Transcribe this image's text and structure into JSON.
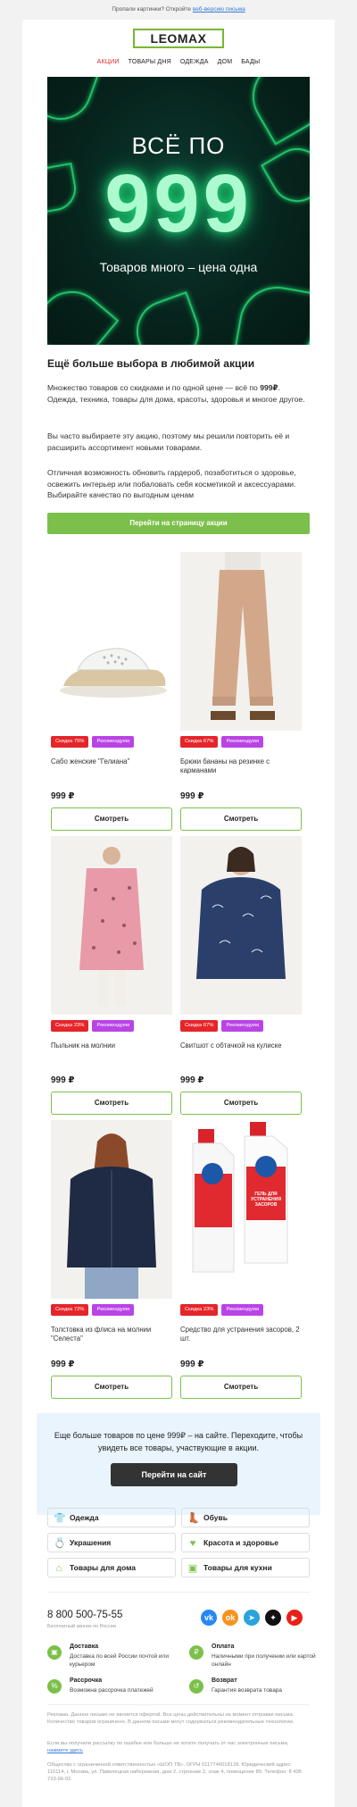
{
  "preheader": {
    "text": "Пропали картинки? Откройте",
    "link": "веб-версию письма"
  },
  "logo": "LEOMAX",
  "nav": [
    {
      "label": "АКЦИИ",
      "active": true
    },
    {
      "label": "ТОВАРЫ ДНЯ",
      "active": false
    },
    {
      "label": "ОДЕЖДА",
      "active": false
    },
    {
      "label": "ДОМ",
      "active": false
    },
    {
      "label": "БАДЫ",
      "active": false
    }
  ],
  "hero": {
    "line1": "ВСЁ ПО",
    "number": "999",
    "line2": "Товаров много – цена одна"
  },
  "intro": {
    "title": "Ещё больше выбора в любимой акции",
    "p1_a": "Множество товаров со скидками и по одной цене — всё по ",
    "p1_bold": "999₽",
    "p1_b": ". Одежда, техника, товары для дома, красоты, здоровья и многое другое.",
    "p2": "Вы часто выбираете эту акцию, поэтому мы решили повторить её и расширить ассортимент новыми товарами.",
    "p3": "Отличная возможность обновить гардероб, позаботиться о здоровье, освежить интерьер или побаловать себя косметикой и аксессуарами. Выбирайте качество по выгодным ценам",
    "cta": "Перейти на страницу акции"
  },
  "products": [
    {
      "name": "Сабо женские \"Гелиана\"",
      "sale": "Скидка 75%",
      "rec": "Рекомендуем",
      "price": "999 ₽",
      "button": "Смотреть"
    },
    {
      "name": "Брюки бананы на резинке с карманами",
      "sale": "Скидка 67%",
      "rec": "Рекомендуем",
      "price": "999 ₽",
      "button": "Смотреть"
    },
    {
      "name": "Пыльник на молнии",
      "sale": "Скидка 23%",
      "rec": "Рекомендуем",
      "price": "999 ₽",
      "button": "Смотреть"
    },
    {
      "name": "Свитшот с обтачкой на кулиске",
      "sale": "Скидка 67%",
      "rec": "Рекомендуем",
      "price": "999 ₽",
      "button": "Смотреть"
    },
    {
      "name": "Толстовка из флиса на молнии \"Селеста\"",
      "sale": "Скидка 72%",
      "rec": "Рекомендуем",
      "price": "999 ₽",
      "button": "Смотреть"
    },
    {
      "name": "Средство для устранения засоров, 2 шт.",
      "sale": "Скидка 23%",
      "rec": "Рекомендуем",
      "price": "999 ₽",
      "button": "Смотреть"
    }
  ],
  "product_label_text": "ГЕЛЬ ДЛЯ УСТРАНЕНИЯ ЗАСОРОВ",
  "more": {
    "text": "Еще больше товаров по цене 999₽ – на сайте. Переходите, чтобы увидеть все товары, участвующие в акции.",
    "button": "Перейти на сайт"
  },
  "categories": [
    {
      "label": "Одежда",
      "icon": "tshirt-icon"
    },
    {
      "label": "Обувь",
      "icon": "shoe-icon"
    },
    {
      "label": "Украшения",
      "icon": "ring-icon"
    },
    {
      "label": "Красота и здоровье",
      "icon": "heart-icon"
    },
    {
      "label": "Товары для дома",
      "icon": "house-icon"
    },
    {
      "label": "Товары для кухни",
      "icon": "kitchen-icon"
    }
  ],
  "footer": {
    "phone": "8 800 500-75-55",
    "phone_sub": "Бесплатный звонок по России",
    "social": [
      {
        "name": "vk-icon",
        "glyph": "vk",
        "color": "#2787f5"
      },
      {
        "name": "ok-icon",
        "glyph": "ok",
        "color": "#f7931e"
      },
      {
        "name": "telegram-icon",
        "glyph": "➤",
        "color": "#2aa3dc"
      },
      {
        "name": "dzen-icon",
        "glyph": "✦",
        "color": "#111111"
      },
      {
        "name": "youtube-icon",
        "glyph": "▶",
        "color": "#e62117"
      }
    ],
    "services": [
      {
        "title": "Доставка",
        "desc": "Доставка по всей России почтой или курьером",
        "icon": "box-icon"
      },
      {
        "title": "Оплата",
        "desc": "Наличными при получении или картой онлайн",
        "icon": "ruble-icon"
      },
      {
        "title": "Рассрочка",
        "desc": "Возможна рассрочка платежей",
        "icon": "percent-icon"
      },
      {
        "title": "Возврат",
        "desc": "Гарантия возврата товара",
        "icon": "return-icon"
      }
    ],
    "legal1": "Реклама. Данное письмо не является офертой. Все цены действительны на момент отправки письма. Количество товаров ограничено. В данном письме могут содержаться рекомендательные технологии.",
    "legal2_a": "Если вы получили рассылку по ошибке или больше не хотите получать от нас электронные письма,",
    "legal2_link": "нажмите здесь",
    "legal3": "Общество с ограниченной ответственностью «ШОП ТВ», ОГРН 5117746018128. Юридический адрес: 115114, г. Москва, ул. Павелецкая набережная, дом 2, строение 2, этаж 4, помещение 89. Телефон: 8 495 733-96-02."
  },
  "colors": {
    "accent_green": "#7cc04b",
    "sale_red": "#e5252a",
    "rec_purple": "#b944e6",
    "link_blue": "#3a7bd5"
  }
}
